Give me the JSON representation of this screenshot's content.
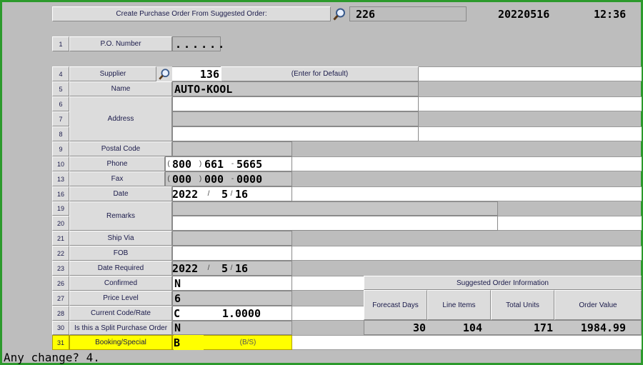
{
  "header": {
    "title": "Create Purchase Order From Suggested Order:",
    "order_no": "226",
    "date": "20220516",
    "time": "12:36",
    "search_icon": "magnifier-icon"
  },
  "fields": {
    "po": {
      "num": "1",
      "label": "P.O. Number",
      "value": "......"
    },
    "supplier": {
      "num": "4",
      "label": "Supplier",
      "value": "136",
      "hint": "(Enter for Default)"
    },
    "name": {
      "num": "5",
      "label": "Name",
      "value": "AUTO-KOOL"
    },
    "address": {
      "nums": [
        "6",
        "7",
        "8"
      ],
      "label": "Address"
    },
    "postal": {
      "num": "9",
      "label": "Postal Code"
    },
    "phone": {
      "num": "10",
      "label": "Phone",
      "area": "800",
      "prefix": "661",
      "line": "5665"
    },
    "fax": {
      "num": "13",
      "label": "Fax",
      "area": "000",
      "prefix": "000",
      "line": "0000"
    },
    "date": {
      "num": "16",
      "label": "Date",
      "year": "2022",
      "month": "5",
      "day": "16"
    },
    "remarks": {
      "nums": [
        "19",
        "20"
      ],
      "label": "Remarks"
    },
    "shipvia": {
      "num": "21",
      "label": "Ship Via"
    },
    "fob": {
      "num": "22",
      "label": "FOB"
    },
    "datereq": {
      "num": "23",
      "label": "Date Required",
      "year": "2022",
      "month": "5",
      "day": "16"
    },
    "confirmed": {
      "num": "26",
      "label": "Confirmed",
      "value": "N"
    },
    "pricelevel": {
      "num": "27",
      "label": "Price Level",
      "value": "6"
    },
    "currency": {
      "num": "28",
      "label": "Current Code/Rate",
      "code": "C",
      "rate": "1.0000"
    },
    "split": {
      "num": "30",
      "label": "Is this a Split Purchase Order",
      "value": "N"
    },
    "booking": {
      "num": "31",
      "label": "Booking/Special",
      "value": "B",
      "hint": "(B/S)"
    }
  },
  "suggested": {
    "title": "Suggested Order Information",
    "headers": [
      "Forecast Days",
      "Line Items",
      "Total Units",
      "Order Value"
    ],
    "values": [
      "30",
      "104",
      "171",
      "1984.99"
    ]
  },
  "punct": {
    "open": "(",
    "close": ")",
    "dash": "-",
    "slash": "/"
  },
  "prompt": "Any change? 4.",
  "colors": {
    "border": "#2c9a2c",
    "highlight": "#ffff00",
    "panel": "#bdbdbd"
  }
}
